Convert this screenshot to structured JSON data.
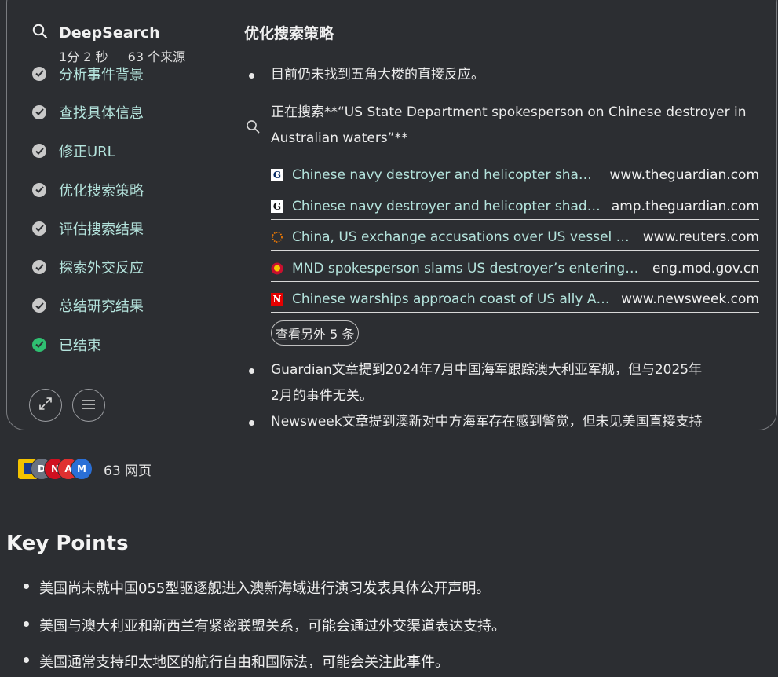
{
  "deepsearch": {
    "title": "DeepSearch",
    "duration": "1分 2 秒",
    "sources": "63 个来源"
  },
  "steps": [
    {
      "label": "分析事件背景",
      "status": "done"
    },
    {
      "label": "查找具体信息",
      "status": "done"
    },
    {
      "label": "修正URL",
      "status": "done"
    },
    {
      "label": "优化搜索策略",
      "status": "done"
    },
    {
      "label": "评估搜索结果",
      "status": "done"
    },
    {
      "label": "探索外交反应",
      "status": "done"
    },
    {
      "label": "总结研究结果",
      "status": "done"
    },
    {
      "label": "已结束",
      "status": "finished"
    }
  ],
  "detail": {
    "title": "优化搜索策略",
    "bullet1": "目前仍未找到五角大楼的直接反应。",
    "searching_line1": "正在搜索**“US State Department spokesperson on Chinese destroyer in",
    "searching_line2": "Australian waters”**",
    "results": [
      {
        "title": "Chinese navy destroyer and helicopter shadow...",
        "domain": "www.theguardian.com",
        "icon": "guardian-icon"
      },
      {
        "title": "Chinese navy destroyer and helicopter shadow...",
        "domain": "amp.theguardian.com",
        "icon": "guardian-icon"
      },
      {
        "title": "China, US exchange accusations over US vessel in S...",
        "domain": "www.reuters.com",
        "icon": "reuters-icon"
      },
      {
        "title": "MND spokesperson slams US destroyer’s entering Chi...",
        "domain": "eng.mod.gov.cn",
        "icon": "mod-emblem-icon"
      },
      {
        "title": "Chinese warships approach coast of US ally Aus...",
        "domain": "www.newsweek.com",
        "icon": "newsweek-icon"
      }
    ],
    "more_button": "查看另外 5 条",
    "bullet2_line1": "Guardian文章提到2024年7月中国海军跟踪澳大利亚军舰，但与2025年",
    "bullet2_line2": "2月的事件无关。",
    "bullet3": "Newsweek文章提到澳新对中方海军存在感到警觉，但未见美国直接支持"
  },
  "web_sources": {
    "count_label": "63 网页"
  },
  "key_points": {
    "title": "Key Points",
    "items": [
      "美国尚未就中国055型驱逐舰进入澳新海域进行演习发表具体公开声明。",
      "美国与澳大利亚和新西兰有紧密联盟关系，可能会通过外交渠道表达支持。",
      "美国通常支持印太地区的航行自由和国际法，可能会关注此事件。"
    ]
  },
  "colors": {
    "background": "#2c2e32",
    "link_text": "#b4e3dc",
    "done_check": "#c9c9c9",
    "finished_check": "#2fbf71"
  }
}
